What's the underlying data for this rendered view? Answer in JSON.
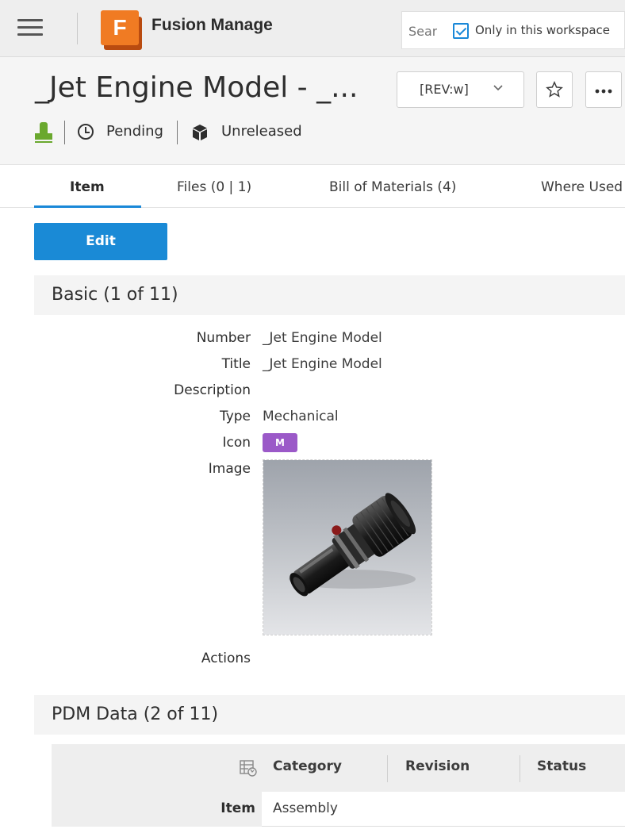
{
  "app": {
    "name": "Fusion Manage",
    "logo_letter": "F"
  },
  "topbar": {
    "search_placeholder": "Search",
    "scope_checkbox_label": "Only in this workspace",
    "scope_checked": true
  },
  "header": {
    "title": "_Jet Engine Model - _...",
    "revision": "[REV:w]",
    "status": "Pending",
    "release_state": "Unreleased"
  },
  "tabs": [
    {
      "label": "Item",
      "active": true
    },
    {
      "label": "Files (0 | 1)",
      "active": false
    },
    {
      "label": "Bill of Materials (4)",
      "active": false
    },
    {
      "label": "Where Used",
      "active": false
    }
  ],
  "actions": {
    "edit_label": "Edit"
  },
  "sections": {
    "basic": {
      "title": "Basic (1 of 11)",
      "fields": {
        "number": {
          "label": "Number",
          "value": "_Jet Engine Model"
        },
        "title": {
          "label": "Title",
          "value": "_Jet Engine Model"
        },
        "description": {
          "label": "Description",
          "value": ""
        },
        "type": {
          "label": "Type",
          "value": "Mechanical"
        },
        "icon": {
          "label": "Icon",
          "value": "M",
          "color": "#9b59c8"
        },
        "image": {
          "label": "Image"
        },
        "actions": {
          "label": "Actions"
        }
      }
    },
    "pdm": {
      "title": "PDM Data (2 of 11)",
      "columns": [
        "Category",
        "Revision",
        "Status"
      ],
      "rows": [
        {
          "label": "Item",
          "category": "Assembly",
          "revision": "",
          "status": ""
        }
      ]
    }
  },
  "colors": {
    "accent": "#1a8ad6",
    "brand_orange": "#f07b23",
    "lifecycle_green": "#6aa82e"
  }
}
